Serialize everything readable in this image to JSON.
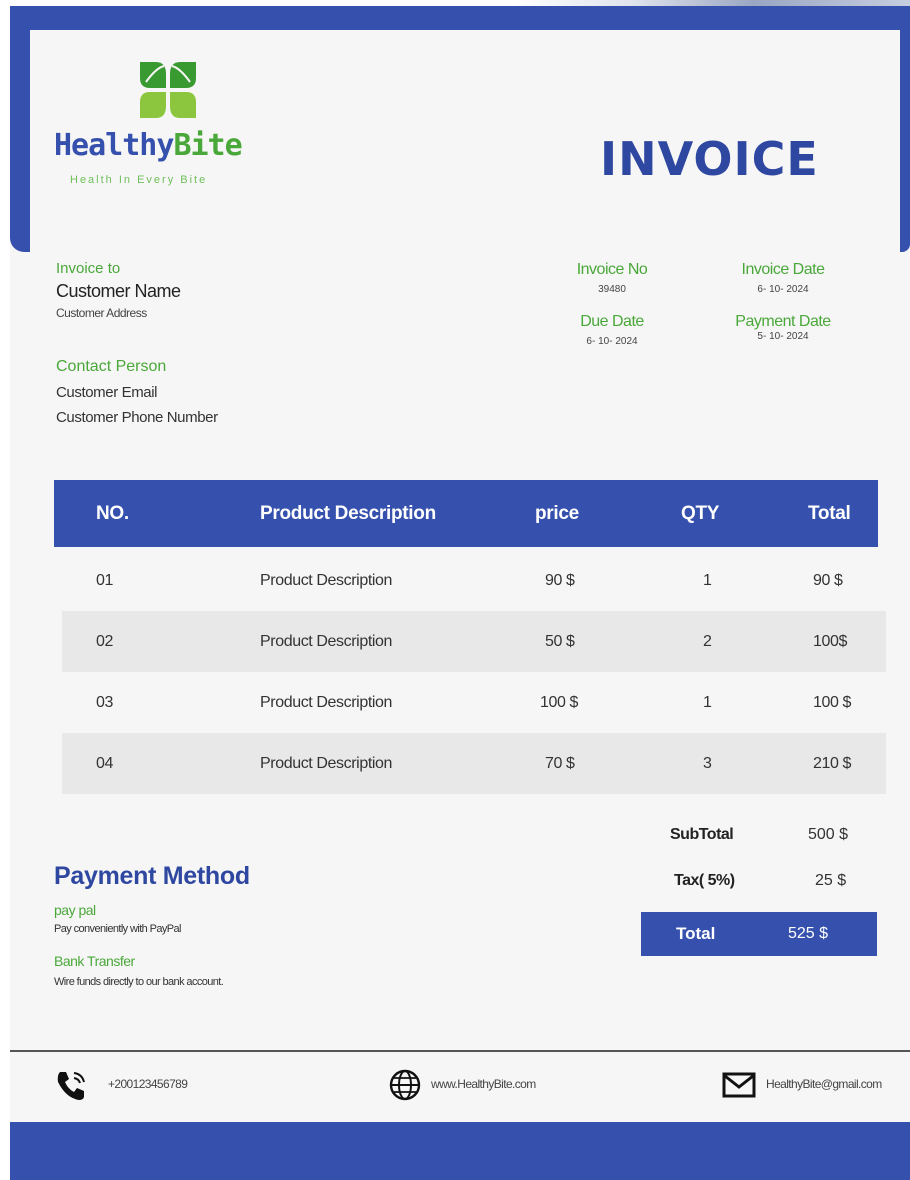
{
  "brand": {
    "name_part1": "Healthy",
    "name_part2": "Bite",
    "tagline": "Health In Every Bite"
  },
  "document_title": "INVOICE",
  "bill_to": {
    "label": "Invoice to",
    "name": "Customer Name",
    "address": "Customer Address",
    "contact_label": "Contact Person",
    "email": "Customer Email",
    "phone": "Customer Phone Number"
  },
  "meta": {
    "invoice_no": {
      "label": "Invoice No",
      "value": "39480"
    },
    "invoice_date": {
      "label": "Invoice Date",
      "value": "6- 10- 2024"
    },
    "due_date": {
      "label": "Due Date",
      "value": "6- 10- 2024"
    },
    "payment_date": {
      "label": "Payment Date",
      "value": "5- 10- 2024"
    }
  },
  "table": {
    "headers": [
      "NO.",
      "Product Description",
      "price",
      "QTY",
      "Total"
    ],
    "rows": [
      {
        "no": "01",
        "description": "Product Description",
        "price": "90 $",
        "qty": "1",
        "total": "90 $"
      },
      {
        "no": "02",
        "description": "Product Description",
        "price": "50 $",
        "qty": "2",
        "total": "100$"
      },
      {
        "no": "03",
        "description": "Product Description",
        "price": "100 $",
        "qty": "1",
        "total": "100 $"
      },
      {
        "no": "04",
        "description": "Product Description",
        "price": "70 $",
        "qty": "3",
        "total": "210 $"
      }
    ]
  },
  "summary": {
    "subtotal_label": "SubTotal",
    "subtotal_value": "500 $",
    "tax_label": "Tax( 5%)",
    "tax_value": "25 $",
    "total_label": "Total",
    "total_value": "525 $"
  },
  "payment": {
    "title": "Payment Method",
    "methods": [
      {
        "name": "pay pal",
        "description": "Pay conveniently with PayPal"
      },
      {
        "name": "Bank Transfer",
        "description": "Wire funds directly to our bank account."
      }
    ]
  },
  "footer": {
    "phone": "+200123456789",
    "website": "www.HealthyBite.com",
    "email": "HealthyBite@gmail.com",
    "icons": [
      "phone-icon",
      "globe-icon",
      "mail-icon"
    ]
  },
  "colors": {
    "primary": "#3651ad",
    "accent_green": "#4aa83a",
    "paper": "#f6f6f6",
    "row_alt": "#e8e8e8"
  }
}
